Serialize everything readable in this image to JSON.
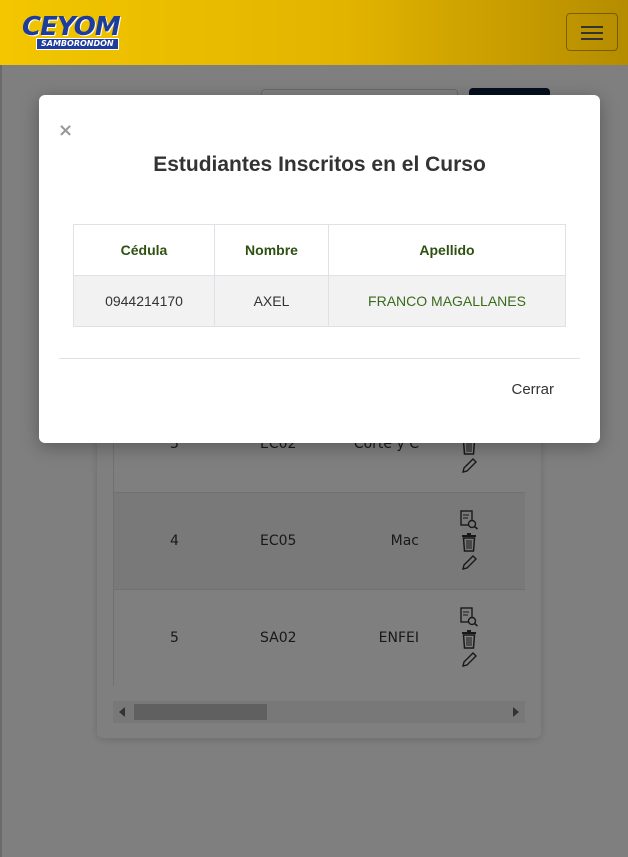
{
  "navbar": {
    "logo_text": "CEYOM",
    "logo_subtext": "SAMBORONDÓN",
    "menu_icon": "hamburger-icon",
    "brand_color": "#e2b400"
  },
  "background_table": {
    "rows": [
      {
        "num": "3",
        "code": "EC02",
        "name": "Corte y C"
      },
      {
        "num": "4",
        "code": "EC05",
        "name": "Mac"
      },
      {
        "num": "5",
        "code": "SA02",
        "name": "ENFEI"
      }
    ],
    "row_action_icons": [
      "view-details-icon",
      "trash-icon",
      "pencil-icon"
    ]
  },
  "modal": {
    "close_symbol": "×",
    "title": "Estudiantes Inscritos en el Curso",
    "table": {
      "headers": [
        "Cédula",
        "Nombre",
        "Apellido"
      ],
      "rows": [
        {
          "cedula": "0944214170",
          "nombre": "AXEL",
          "apellido": "FRANCO MAGALLANES"
        }
      ]
    },
    "close_button_label": "Cerrar"
  }
}
